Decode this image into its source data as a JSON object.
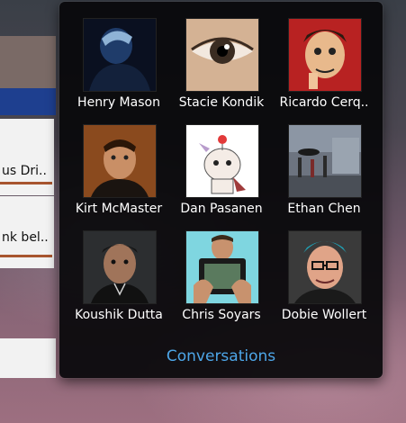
{
  "background": {
    "snippets": [
      "us Dri..",
      "nk bel.."
    ]
  },
  "popup": {
    "contacts": [
      {
        "name": "Henry Mason"
      },
      {
        "name": "Stacie Kondik"
      },
      {
        "name": "Ricardo Cerq.."
      },
      {
        "name": "Kirt McMaster"
      },
      {
        "name": "Dan Pasanen"
      },
      {
        "name": "Ethan Chen"
      },
      {
        "name": "Koushik Dutta"
      },
      {
        "name": "Chris Soyars"
      },
      {
        "name": "Dobie Wollert"
      }
    ],
    "footer_label": "Conversations"
  },
  "colors": {
    "accent": "#4da6e8",
    "panel": "#08080a"
  }
}
